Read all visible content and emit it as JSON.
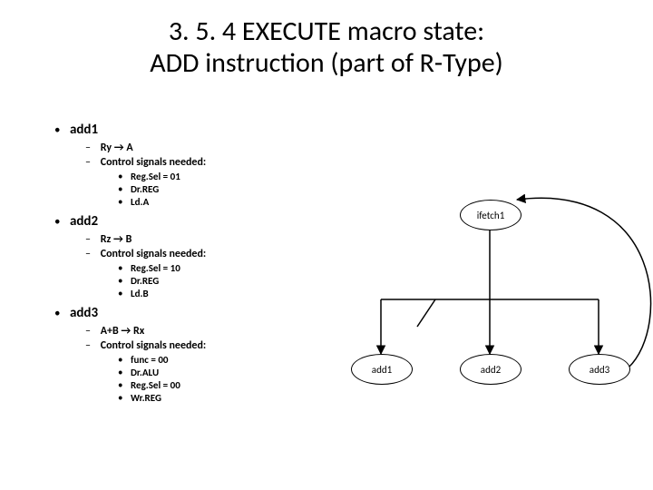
{
  "title_line1": "3. 5. 4 EXECUTE macro state:",
  "title_line2": "ADD instruction (part of R-Type)",
  "sections": [
    {
      "head": "add1",
      "op_lhs": "Ry",
      "op_rhs": "A",
      "signals_label": "Control signals needed:",
      "signals": [
        "Reg.Sel = 01",
        "Dr.REG",
        "Ld.A"
      ]
    },
    {
      "head": "add2",
      "op_lhs": "Rz",
      "op_rhs": "B",
      "signals_label": "Control signals needed:",
      "signals": [
        "Reg.Sel = 10",
        "Dr.REG",
        "Ld.B"
      ]
    },
    {
      "head": "add3",
      "op_lhs": "A+B",
      "op_rhs": "Rx",
      "signals_label": "Control signals needed:",
      "signals": [
        "func = 00",
        "Dr.ALU",
        "Reg.Sel = 00",
        "Wr.REG"
      ]
    }
  ],
  "bullets": {
    "l1": "•",
    "l2": "–",
    "l3": "•"
  },
  "arrow_glyph": "→",
  "diagram": {
    "nodes": {
      "ifetch1": "ifetch1",
      "add1": "add1",
      "add2": "add2",
      "add3": "add3"
    }
  }
}
